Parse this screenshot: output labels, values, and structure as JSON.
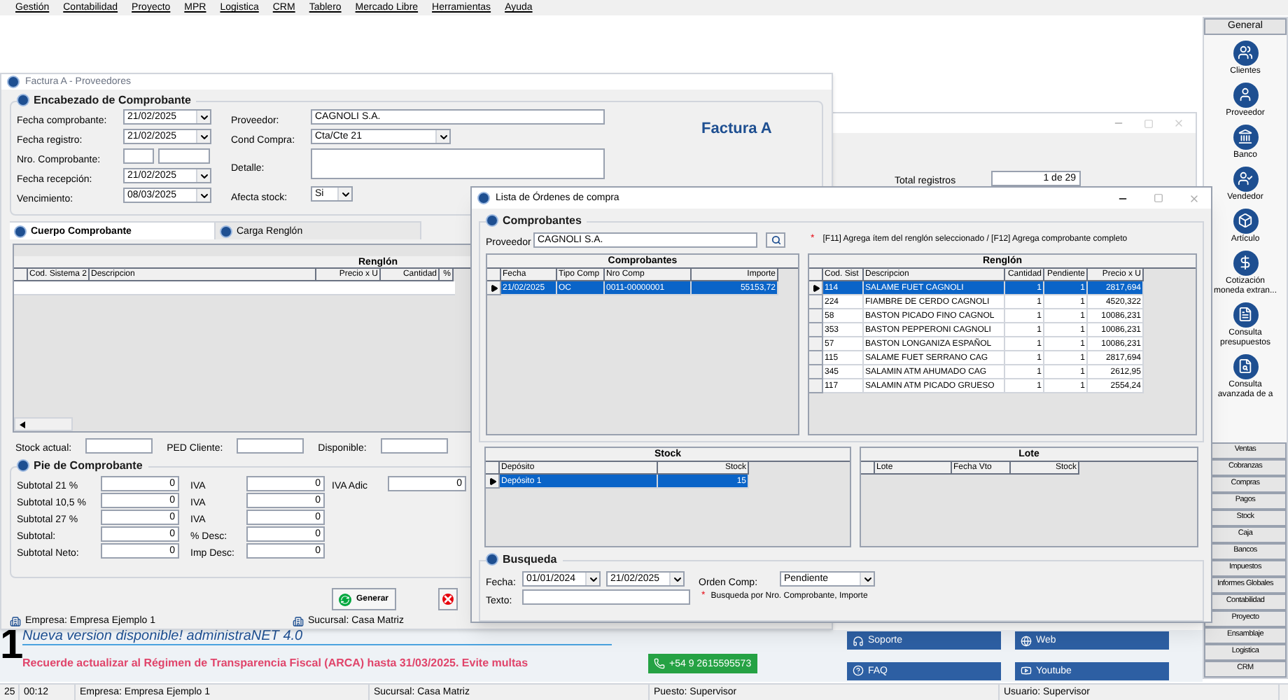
{
  "menu": [
    "Gestión",
    "Contabilidad",
    "Proyecto",
    "MPR",
    "Logistica",
    "CRM",
    "Tablero",
    "Mercado Libre",
    "Herramientas",
    "Ayuda"
  ],
  "back_window": {
    "total_label": "Total registros",
    "total_value": "1 de 29"
  },
  "factura": {
    "title": "Factura A - Proveedores",
    "doc_type": "Factura A",
    "header_title": "Encabezado de Comprobante",
    "left_fields": [
      {
        "label": "Fecha comprobante:",
        "kind": "combo",
        "value": "21/02/2025"
      },
      {
        "label": "Fecha registro:",
        "kind": "combo",
        "value": "21/02/2025"
      },
      {
        "label": "Nro. Comprobante:",
        "kind": "split"
      },
      {
        "label": "Fecha recepción:",
        "kind": "combo",
        "value": "21/02/2025"
      },
      {
        "label": "Vencimiento:",
        "kind": "combo",
        "value": "08/03/2025"
      }
    ],
    "right_fields": [
      {
        "label": "Proveedor:",
        "kind": "text",
        "value": "CAGNOLI S.A."
      },
      {
        "label": "Cond Compra:",
        "kind": "combo",
        "value": "Cta/Cte 21"
      },
      {
        "label": "Detalle:",
        "kind": "memo"
      },
      {
        "label": "Afecta stock:",
        "kind": "combo",
        "value": "Si"
      }
    ],
    "tabs": [
      {
        "label": "Cuerpo Comprobante",
        "selected": true
      },
      {
        "label": "Carga Renglón",
        "selected": false
      }
    ],
    "grid_title": "Renglón",
    "grid_columns": [
      "Cod. Sistema 2",
      "Descripcion",
      "Precio x U",
      "Cantidad",
      "%"
    ],
    "stock_fields": [
      "Stock actual:",
      "PED Cliente:",
      "Disponible:"
    ],
    "footer_title": "Pie de Comprobante",
    "footer_rows": [
      [
        {
          "label": "Subtotal 21 %",
          "value": "0"
        },
        {
          "label": "IVA",
          "value": "0"
        },
        {
          "label": "IVA Adic",
          "value": "0"
        }
      ],
      [
        {
          "label": "Subtotal 10,5 %",
          "value": "0"
        },
        {
          "label": "IVA",
          "value": "0"
        }
      ],
      [
        {
          "label": "Subtotal 27 %",
          "value": "0"
        },
        {
          "label": "IVA",
          "value": "0"
        }
      ],
      [
        {
          "label": "Subtotal:",
          "value": "0"
        },
        {
          "label": "% Desc:",
          "value": "0"
        }
      ],
      [
        {
          "label": "Subtotal Neto:",
          "value": "0"
        },
        {
          "label": "Imp Desc:",
          "value": "0"
        }
      ]
    ],
    "generate_button": "Generar",
    "status": [
      "Empresa: Empresa Ejemplo 1",
      "Sucursal: Casa Matriz"
    ]
  },
  "lista": {
    "title": "Lista de Órdenes de compra",
    "group_title": "Comprobantes",
    "provider_label": "Proveedor",
    "provider_value": "CAGNOLI S.A.",
    "hint_mark": "*",
    "hint": "[F11] Agrega ítem del renglón seleccionado / [F12] Agrega comprobante completo",
    "tables": [
      {
        "title": "Comprobantes",
        "columns": [
          "Fecha",
          "Tipo Comp",
          "Nro Comp",
          "Importe"
        ],
        "rows": [
          {
            "cells": [
              "21/02/2025",
              "OC",
              "0011-00000001",
              "55153,72"
            ],
            "selected": true
          }
        ]
      },
      {
        "title": "Renglón",
        "columns": [
          "Cod. Sist",
          "Descripcion",
          "Cantidad",
          "Pendiente",
          "Precio x U"
        ],
        "rows": [
          {
            "cells": [
              "114",
              "SALAME FUET CAGNOLI",
              "1",
              "1",
              "2817,694"
            ],
            "selected": true
          },
          {
            "cells": [
              "224",
              "FIAMBRE DE CERDO  CAGNOLI",
              "1",
              "1",
              "4520,322"
            ],
            "selected": false
          },
          {
            "cells": [
              "58",
              "BASTON PICADO FINO CAGNOL",
              "1",
              "1",
              "10086,231"
            ],
            "selected": false
          },
          {
            "cells": [
              "353",
              "BASTON PEPPERONI CAGNOLI",
              "1",
              "1",
              "10086,231"
            ],
            "selected": false
          },
          {
            "cells": [
              "57",
              "BASTON LONGANIZA ESPAÑOL",
              "1",
              "1",
              "10086,231"
            ],
            "selected": false
          },
          {
            "cells": [
              "115",
              "SALAME FUET SERRANO CAG",
              "1",
              "1",
              "2817,694"
            ],
            "selected": false
          },
          {
            "cells": [
              "345",
              "SALAMIN ATM  AHUMADO CAG",
              "1",
              "1",
              "2612,95"
            ],
            "selected": false
          },
          {
            "cells": [
              "117",
              "SALAMIN ATM PICADO GRUESO",
              "1",
              "1",
              "2554,24"
            ],
            "selected": false
          }
        ]
      },
      {
        "title": "Stock",
        "columns": [
          "Depósito",
          "Stock"
        ],
        "rows": [
          {
            "cells": [
              "Depósito 1",
              "15"
            ],
            "selected": true
          }
        ]
      },
      {
        "title": "Lote",
        "columns": [
          "Lote",
          "Fecha Vto",
          "Stock"
        ]
      }
    ],
    "search_title": "Busqueda",
    "date_label": "Fecha:",
    "date_from": "01/01/2024",
    "date_to": "21/02/2025",
    "order_label": "Orden Comp:",
    "order_value": "Pendiente",
    "text_label": "Texto:",
    "search_note_mark": "*",
    "search_note": "Busqueda por Nro. Comprobante, Importe"
  },
  "sidebar": {
    "header": "General",
    "items": [
      "Clientes",
      "Proveedor",
      "Banco",
      "Vendedor",
      "Artículo",
      "Cotización moneda extran...",
      "Consulta presupuestos",
      "Consulta avanzada de a"
    ],
    "sections": [
      "Ventas",
      "Cobranzas",
      "Compras",
      "Pagos",
      "Stock",
      "Caja",
      "Bancos",
      "Impuestos",
      "Informes Globales",
      "Contabilidad",
      "Proyecto",
      "Ensamblaje",
      "Logistica",
      "CRM"
    ]
  },
  "banner": {
    "logo_fragment": "1",
    "news": "Nueva version disponible! administraNET 4.0",
    "alert": "Recuerde actualizar al Régimen de Transparencia Fiscal (ARCA) hasta 31/03/2025. Evite multas",
    "whatsapp": "+54 9 2615595573",
    "links": [
      "Soporte",
      "Web",
      "FAQ",
      "Youtube"
    ]
  },
  "status_bar": [
    "25",
    "00:12",
    "Empresa: Empresa Ejemplo 1",
    "Sucursal: Casa Matriz",
    "Puesto: Supervisor",
    "Usuario: Supervisor"
  ]
}
